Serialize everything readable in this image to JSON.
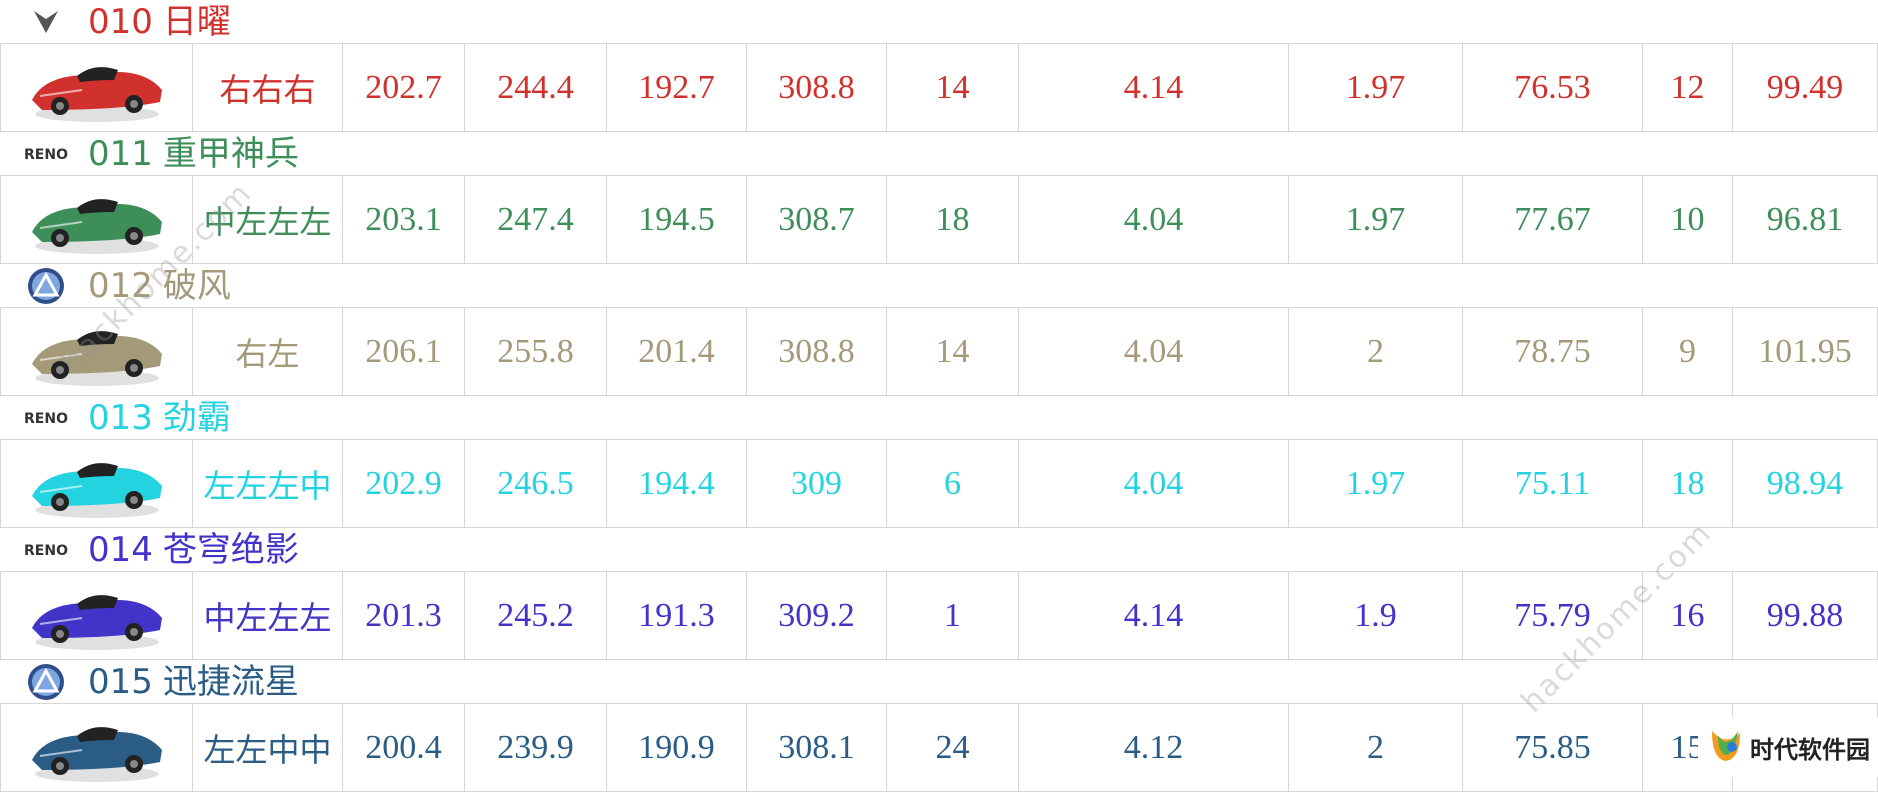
{
  "colors": {
    "red": "#d0312d",
    "green": "#3e8e5a",
    "tan": "#a49a7a",
    "cyan": "#23d3e0",
    "indigo": "#4233c9",
    "slate": "#2a5c85"
  },
  "cars": [
    {
      "badge": "chevron",
      "code": "010",
      "name": "日曜",
      "color": "#d0312d",
      "car_icon": "red-race-car-icon",
      "direction": "右右右",
      "values": [
        "202.7",
        "244.4",
        "192.7",
        "308.8",
        "14",
        "4.14",
        "1.97",
        "76.53",
        "12",
        "99.49"
      ]
    },
    {
      "badge": "reno",
      "badge_text": "RENO",
      "code": "011",
      "name": "重甲神兵",
      "color": "#3e8e5a",
      "car_icon": "green-race-car-icon",
      "direction": "中左左左",
      "values": [
        "203.1",
        "247.4",
        "194.5",
        "308.7",
        "18",
        "4.04",
        "1.97",
        "77.67",
        "10",
        "96.81"
      ]
    },
    {
      "badge": "circle",
      "code": "012",
      "name": "破风",
      "color": "#a49a7a",
      "car_icon": "yellow-race-car-icon",
      "direction": "右左",
      "values": [
        "206.1",
        "255.8",
        "201.4",
        "308.8",
        "14",
        "4.04",
        "2",
        "78.75",
        "9",
        "101.95"
      ]
    },
    {
      "badge": "reno",
      "badge_text": "RENO",
      "code": "013",
      "name": "劲霸",
      "color": "#23d3e0",
      "car_icon": "black-cyan-race-car-icon",
      "direction": "左左左中",
      "values": [
        "202.9",
        "246.5",
        "194.4",
        "309",
        "6",
        "4.04",
        "1.97",
        "75.11",
        "18",
        "98.94"
      ]
    },
    {
      "badge": "reno",
      "badge_text": "RENO",
      "code": "014",
      "name": "苍穹绝影",
      "color": "#4233c9",
      "car_icon": "blue-race-car-icon",
      "direction": "中左左左",
      "values": [
        "201.3",
        "245.2",
        "191.3",
        "309.2",
        "1",
        "4.14",
        "1.9",
        "75.79",
        "16",
        "99.88"
      ]
    },
    {
      "badge": "circle",
      "code": "015",
      "name": "迅捷流星",
      "color": "#2a5c85",
      "car_icon": "white-blue-race-car-icon",
      "direction": "左左中中",
      "values": [
        "200.4",
        "239.9",
        "190.9",
        "308.1",
        "24",
        "4.12",
        "2",
        "75.85",
        "15",
        ""
      ]
    }
  ],
  "watermark": "hackhome.com",
  "logo": {
    "text": "时代软件园",
    "icon": "leaf-logo-icon"
  }
}
